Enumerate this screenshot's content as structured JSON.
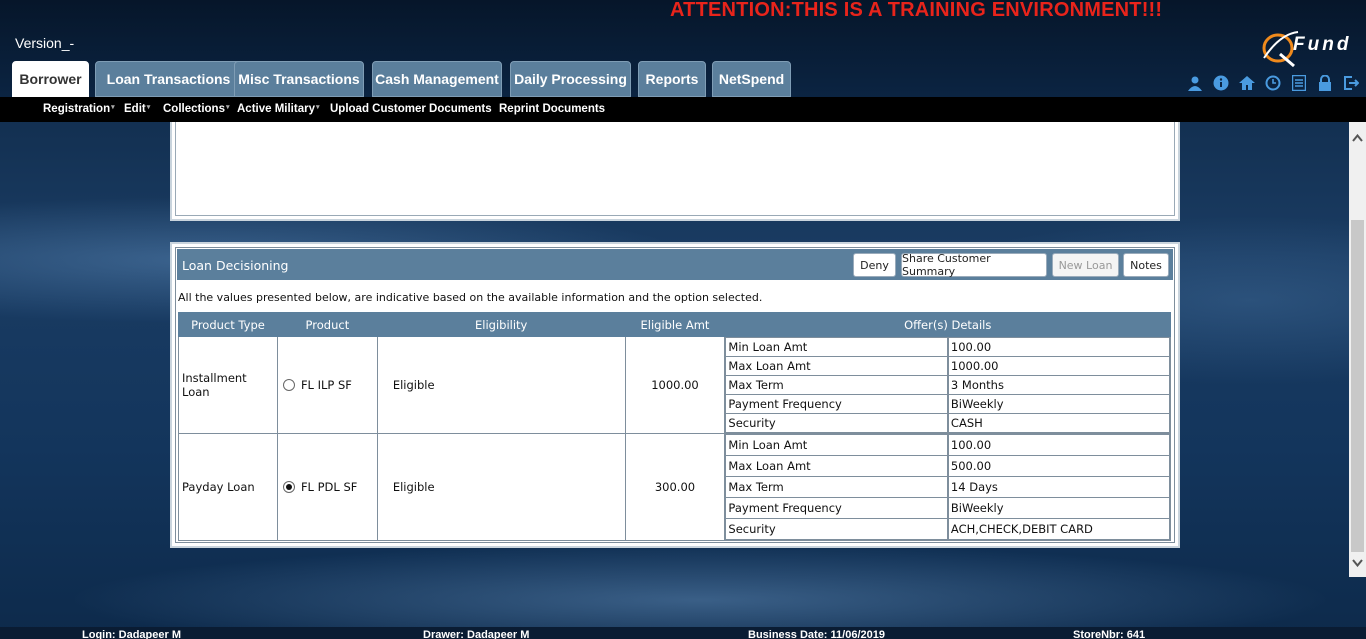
{
  "header": {
    "attention": "ATTENTION:THIS IS A TRAINING ENVIRONMENT!!!",
    "version": "Version_-",
    "logo_text": "Fund",
    "tabs": [
      {
        "label": "Borrower",
        "active": true
      },
      {
        "label": "Loan Transactions"
      },
      {
        "label": "Misc Transactions"
      },
      {
        "label": "Cash Management"
      },
      {
        "label": "Daily Processing"
      },
      {
        "label": "Reports"
      },
      {
        "label": "NetSpend"
      }
    ],
    "icons": [
      "user-icon",
      "info-icon",
      "home-icon",
      "clock-icon",
      "list-icon",
      "lock-icon",
      "logout-icon"
    ]
  },
  "submenu": {
    "items": [
      {
        "label": "Registration",
        "dropdown": true
      },
      {
        "label": "Edit",
        "dropdown": true
      },
      {
        "label": "Collections",
        "dropdown": true
      },
      {
        "label": "Active Military",
        "dropdown": true
      },
      {
        "label": "Upload Customer Documents",
        "dropdown": false
      },
      {
        "label": "Reprint Documents",
        "dropdown": false
      }
    ]
  },
  "loan_decisioning": {
    "title": "Loan Decisioning",
    "buttons": {
      "deny": "Deny",
      "share": "Share Customer Summary",
      "new_loan": "New Loan",
      "notes": "Notes"
    },
    "note": "All the values presented below, are indicative based on the available information and the option selected.",
    "columns": [
      "Product Type",
      "Product",
      "Eligibility",
      "Eligible Amt",
      "Offer(s) Details"
    ],
    "rows": [
      {
        "product_type": "Installment Loan",
        "product": "FL ILP SF",
        "selected": false,
        "eligibility": "Eligible",
        "eligible_amt": "1000.00",
        "offers": [
          {
            "label": "Min Loan Amt",
            "value": "100.00"
          },
          {
            "label": "Max Loan Amt",
            "value": "1000.00"
          },
          {
            "label": "Max Term",
            "value": "3 Months"
          },
          {
            "label": "Payment Frequency",
            "value": "BiWeekly"
          },
          {
            "label": "Security",
            "value": "CASH"
          }
        ]
      },
      {
        "product_type": "Payday Loan",
        "product": "FL PDL SF",
        "selected": true,
        "eligibility": "Eligible",
        "eligible_amt": "300.00",
        "offers": [
          {
            "label": "Min Loan Amt",
            "value": "100.00"
          },
          {
            "label": "Max Loan Amt",
            "value": "500.00"
          },
          {
            "label": "Max Term",
            "value": "14 Days"
          },
          {
            "label": "Payment Frequency",
            "value": "BiWeekly"
          },
          {
            "label": "Security",
            "value": "ACH,CHECK,DEBIT CARD"
          }
        ]
      }
    ]
  },
  "footer": {
    "login": "Login: Dadapeer M",
    "drawer": "Drawer: Dadapeer M",
    "business_date": "Business Date: 11/06/2019",
    "store": "StoreNbr: 641"
  },
  "colors": {
    "accent": "#5b7f9c",
    "attention": "#e8241b",
    "icon": "#4a9be0"
  }
}
